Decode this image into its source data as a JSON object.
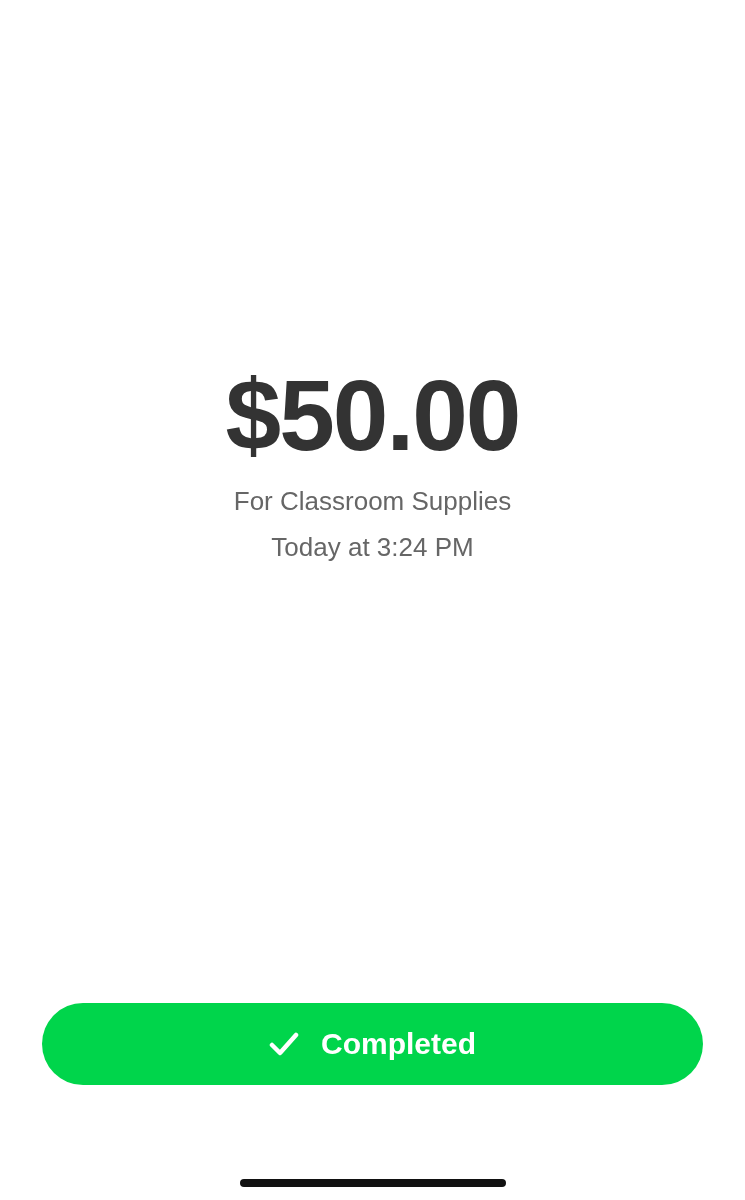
{
  "payment": {
    "amount": "$50.00",
    "note": "For Classroom Supplies",
    "time": "Today at 3:24 PM"
  },
  "status_button": {
    "label": "Completed",
    "kind": "completed"
  }
}
